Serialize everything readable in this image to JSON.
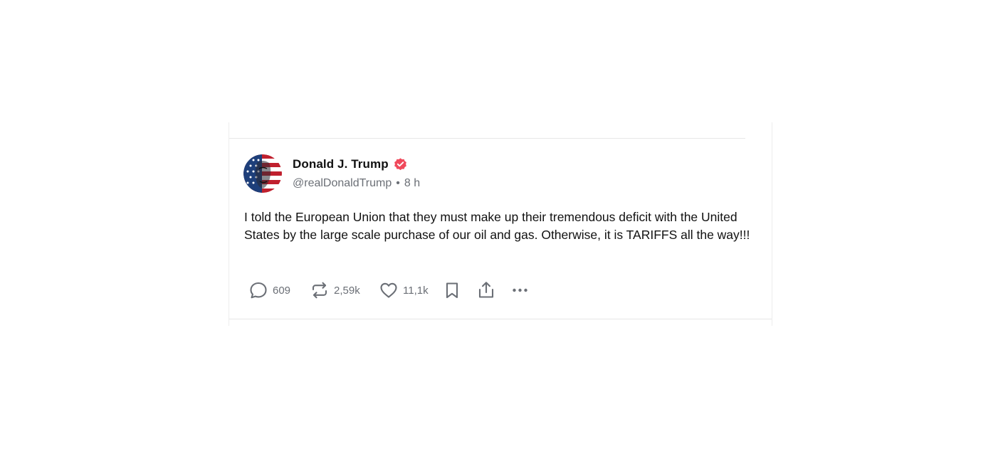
{
  "post": {
    "author": {
      "display_name": "Donald J. Trump",
      "handle": "@realDonaldTrump",
      "verified": true
    },
    "separator": "•",
    "time_ago": "8 h",
    "text": "I told the European Union that they must make up their tremendous deficit with the United States by the large scale purchase of our oil and gas. Otherwise, it is TARIFFS all the way!!!",
    "stats": {
      "replies": "609",
      "reposts": "2,59k",
      "likes": "11,1k"
    }
  },
  "icons": {
    "verified": "verified-badge-icon",
    "reply": "speech-bubble-icon",
    "repost": "repost-arrows-icon",
    "like": "heart-icon",
    "bookmark": "bookmark-icon",
    "share": "share-upload-icon",
    "more": "ellipsis-icon"
  },
  "colors": {
    "verified_badge": "#f0495b",
    "text_primary": "#111111",
    "text_secondary": "#6b6f76",
    "divider": "#e7e7e7"
  }
}
